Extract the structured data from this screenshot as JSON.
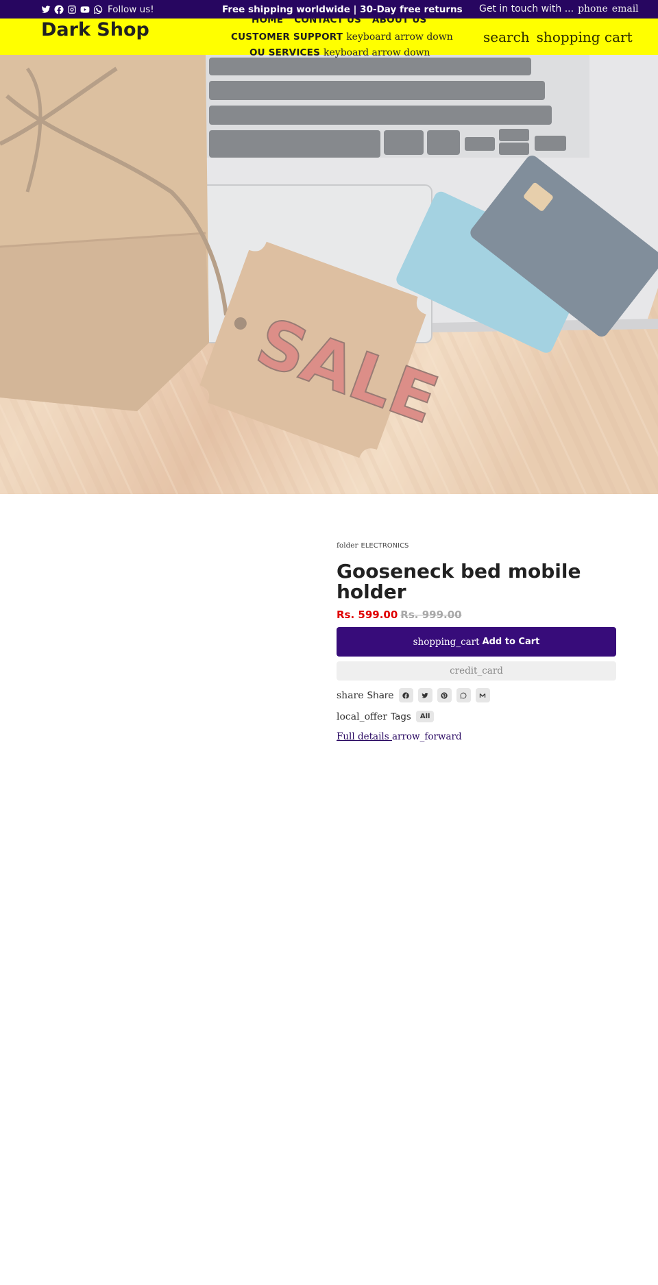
{
  "topbar": {
    "social_icons": [
      "twitter-icon",
      "facebook-icon",
      "instagram-icon",
      "youtube-icon",
      "whatsapp-icon"
    ],
    "follow_label": "Follow us!",
    "announcement": "Free shipping worldwide | 30-Day free returns",
    "contact_label": "Get in touch with ...",
    "contact_icons": {
      "phone": "phone",
      "email": "email"
    }
  },
  "header": {
    "brand": "Dark Shop",
    "nav": {
      "home": "HOME",
      "contact": "CONTACT US",
      "about": "ABOUT US",
      "support": "CUSTOMER SUPPORT",
      "services": "OU SERVICES",
      "dropdown_icon_text": "keyboard_arrow_down",
      "dropdown_icon_words": [
        "keyboard",
        "arrow",
        "down"
      ]
    },
    "icons": {
      "search": "search",
      "cart_words": [
        "shopping",
        "cart"
      ]
    }
  },
  "hero": {
    "alt": "Sale tag on gift box next to laptop and credit cards",
    "tag_text": "SALE"
  },
  "product": {
    "category_icon": "folder",
    "category": "ELECTRONICS",
    "title": "Gooseneck bed mobile holder",
    "price": "Rs. 599.00",
    "compare_price": "Rs. 999.00",
    "add_to_cart_icon": "shopping_cart",
    "add_to_cart_label": "Add to Cart",
    "buy_now_icon": "credit_card",
    "share_icon": "share",
    "share_label": "Share",
    "share_targets": [
      "facebook",
      "twitter",
      "pinterest",
      "whatsapp",
      "email"
    ],
    "tags_icon": "local_offer",
    "tags_label": "Tags",
    "tags": [
      "All"
    ],
    "details_label": "Full details ",
    "details_icon": "arrow_forward"
  },
  "colors": {
    "topbar_bg": "#270660",
    "header_bg": "#FFFF00",
    "primary": "#370C7A",
    "sale_price": "#E00000",
    "compare_price": "#A8A8A8"
  }
}
